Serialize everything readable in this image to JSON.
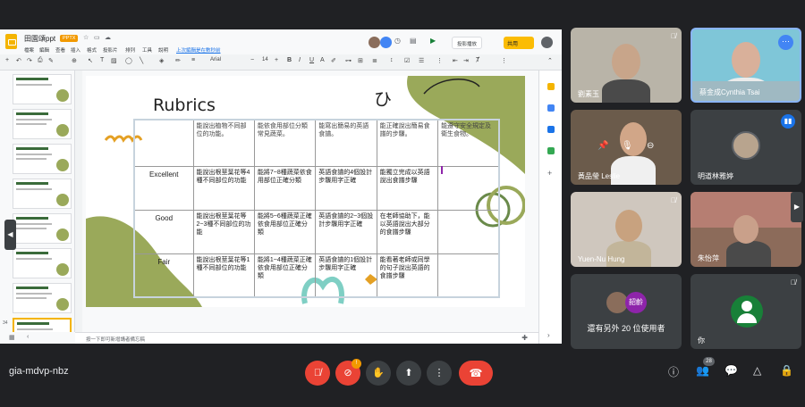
{
  "presentation": {
    "doc_title": "田園頌ppt",
    "doc_badge": "PPTX",
    "menu": [
      "檔案",
      "編輯",
      "查看",
      "插入",
      "格式",
      "投影片",
      "排列",
      "工具",
      "說明"
    ],
    "last_edit": "上次編輯是在數秒前",
    "slideshow_label": "投影播放",
    "share_label": "共用",
    "font_name": "Arial",
    "font_size": "14",
    "notes_placeholder": "按一下即可新增講者備忘稿",
    "thumbnail_numbers": [
      "",
      "",
      "",
      "",
      "",
      "",
      "",
      "34"
    ]
  },
  "slide": {
    "title": "Rubrics",
    "deco_text": "ひ",
    "header_cells": [
      "",
      "能說出植物不同部位的功能。",
      "能依食用部位分類常見蔬菜。",
      "能寫出簡易的英語食譜。",
      "能正確說出簡易食譜的步驟。",
      "能遵守安全規定及衛生食物。"
    ],
    "rows": [
      {
        "level": "Excellent",
        "cells": [
          "能說出根莖葉花等4種不同部位的功能",
          "能將7~8種蔬菜依食用部位正確分類",
          "英語食譜的4個設計步驟用字正確",
          "能獨立完成以英語說出食譜步驟",
          ""
        ]
      },
      {
        "level": "Good",
        "cells": [
          "能說出根莖葉花等2~3種不同部位的功能",
          "能將5~6種蔬菜正確依食用部位正確分類",
          "英語食譜的2~3個設計步驟用字正確",
          "在老師協助下，能以英語說出大部分的食譜步驟",
          ""
        ]
      },
      {
        "level": "Fair",
        "cells": [
          "能說出根莖葉花等1種不同部位的功能",
          "能將1~4種蔬菜正確依食用部位正確分類",
          "英語食譜的1個設計步驟用字正確",
          "能看著老師或同學的句子說出英語的食譜步驟",
          ""
        ]
      }
    ]
  },
  "participants": [
    {
      "name": "劉素玉",
      "muted": true
    },
    {
      "name": "蔡金成Cynthia Tsai",
      "muted": false
    },
    {
      "name": "黃品瑩 Leslie",
      "muted": false
    },
    {
      "name": "明道林雅婷",
      "muted": false
    },
    {
      "name": "Yuen-Nu Hung",
      "muted": true
    },
    {
      "name": "朱怡萍",
      "muted": true
    }
  ],
  "others_tile": {
    "text": "還有另外 20 位使用者",
    "badge_name": "韶齡"
  },
  "self_tile": {
    "name": "你"
  },
  "meeting": {
    "code": "gia-mdvp-nbz",
    "people_count": "28",
    "camera_alert": "!"
  }
}
